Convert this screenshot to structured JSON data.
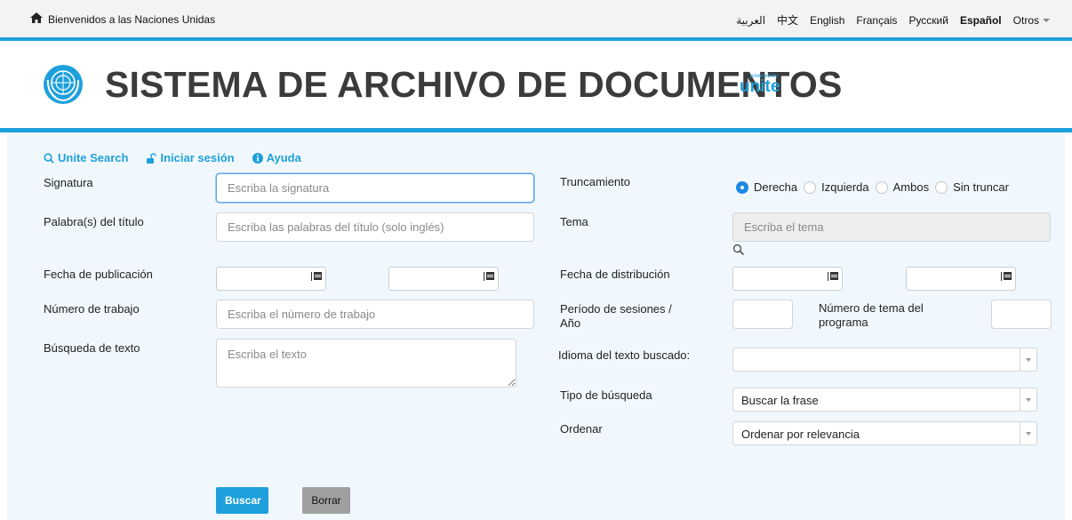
{
  "topbar": {
    "welcome": "Bienvenidos a las Naciones Unidas",
    "languages": [
      "العربية",
      "中文",
      "English",
      "Français",
      "Русский",
      "Español"
    ],
    "active_language": "Español",
    "more": "Otros"
  },
  "header": {
    "title": "SISTEMA DE ARCHIVO DE DOCUMENTOS",
    "powered_small": "powered by",
    "powered_brand": "unite"
  },
  "links": {
    "unite_search": "Unite Search",
    "login": "Iniciar sesión",
    "help": "Ayuda"
  },
  "form": {
    "signatura": {
      "label": "Signatura",
      "placeholder": "Escriba la signatura"
    },
    "titulo": {
      "label": "Palabra(s) del título",
      "placeholder": "Escriba las palabras del título (solo inglés)"
    },
    "fecha_publicacion": {
      "label": "Fecha de publicación"
    },
    "numero_trabajo": {
      "label": "Número de trabajo",
      "placeholder": "Escriba el número de trabajo"
    },
    "busqueda_texto": {
      "label": "Búsqueda de texto",
      "placeholder": "Escriba el texto"
    },
    "truncamiento": {
      "label": "Truncamiento",
      "options": [
        "Derecha",
        "Izquierda",
        "Ambos",
        "Sin truncar"
      ],
      "selected": "Derecha"
    },
    "tema": {
      "label": "Tema",
      "placeholder": "Escriba el tema"
    },
    "fecha_distribucion": {
      "label": "Fecha de distribución"
    },
    "periodo": {
      "label": "Período de sesiones / Año"
    },
    "numero_tema": {
      "label": "Número de tema del programa"
    },
    "idioma": {
      "label": "Idioma del texto buscado:",
      "value": ""
    },
    "tipo_busqueda": {
      "label": "Tipo de búsqueda",
      "value": "Buscar la frase"
    },
    "ordenar": {
      "label": "Ordenar",
      "value": "Ordenar por relevancia"
    }
  },
  "buttons": {
    "search": "Buscar",
    "clear": "Borrar"
  },
  "colors": {
    "accent": "#1ea0dc",
    "panel": "#f1f8fd",
    "radio_on": "#1e88e5"
  }
}
